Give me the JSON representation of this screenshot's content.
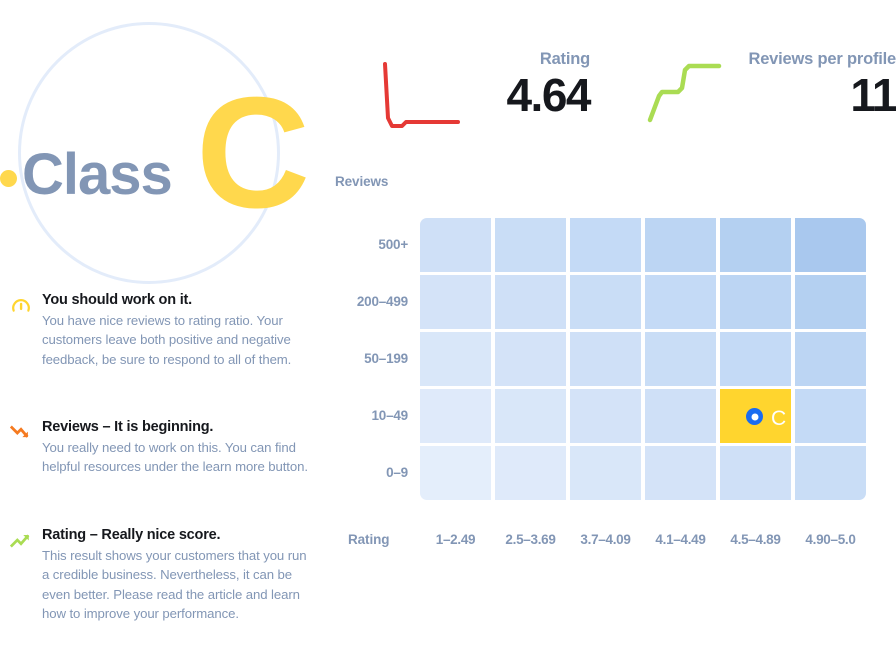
{
  "badge": {
    "class_word": "Class",
    "letter": "C",
    "ring_color": "#e3ecfa",
    "letter_color": "#ffd84d",
    "word_color": "#8296b5",
    "dot_color": "#ffd84d"
  },
  "advice": [
    {
      "icon": "gauge-icon",
      "icon_color": "#ffd52e",
      "title": "You should work on it.",
      "text": "You have nice reviews to rating ratio. Your customers leave both positive and negative feedback, be sure to respond to all of them."
    },
    {
      "icon": "trend-down-icon",
      "icon_color": "#f57a20",
      "title": "Reviews – It is beginning.",
      "text": "You really need to work on this. You can find helpful resources under the learn more button."
    },
    {
      "icon": "trend-up-icon",
      "icon_color": "#aadc53",
      "title": "Rating – Really nice score.",
      "text": "This result shows your customers that you run a credible business. Nevertheless, it can be even better. Please read the article and learn how to improve your performance."
    }
  ],
  "metrics": [
    {
      "name": "rating",
      "label": "Rating",
      "value": "4.64",
      "spark_color": "#e53935",
      "spark_trend": "down"
    },
    {
      "name": "reviews-per-profile",
      "label": "Reviews per profile",
      "value": "11",
      "spark_color": "#aadc53",
      "spark_trend": "up"
    }
  ],
  "chart_data": {
    "type": "heatmap",
    "title": "",
    "xlabel": "Rating",
    "ylabel": "Reviews",
    "categories": [
      "1–2.49",
      "2.5–3.69",
      "3.7–4.09",
      "4.1–4.49",
      "4.5–4.89",
      "4.90–5.0"
    ],
    "rows": [
      "500+",
      "200–499",
      "50–199",
      "10–49",
      "0–9"
    ],
    "legend_position": "none",
    "grid": false,
    "cell_colors": [
      [
        "#cfe0f7",
        "#c9ddf6",
        "#c4daf6",
        "#bcd5f3",
        "#b4d0f1",
        "#a9c8ee"
      ],
      [
        "#d4e3f8",
        "#cfe0f7",
        "#c9ddf6",
        "#c4daf6",
        "#bcd5f3",
        "#b4d0f1"
      ],
      [
        "#d9e7f9",
        "#d4e3f8",
        "#cfe0f7",
        "#c9ddf6",
        "#c4daf6",
        "#bcd5f3"
      ],
      [
        "#dfeafa",
        "#d9e7f9",
        "#d4e3f8",
        "#cfe0f7",
        "#c9ddf6",
        "#c4daf6"
      ],
      [
        "#e4eefb",
        "#dfeafa",
        "#d9e7f9",
        "#d4e3f8",
        "#cfe0f7",
        "#c9ddf6"
      ]
    ],
    "highlight": {
      "row": "10–49",
      "row_index": 3,
      "column": "4.5–4.89",
      "column_index": 4,
      "label": "C",
      "cell_color": "#ffd52e",
      "marker_color": "#1a6cf0",
      "label_color": "#ffffff"
    }
  }
}
